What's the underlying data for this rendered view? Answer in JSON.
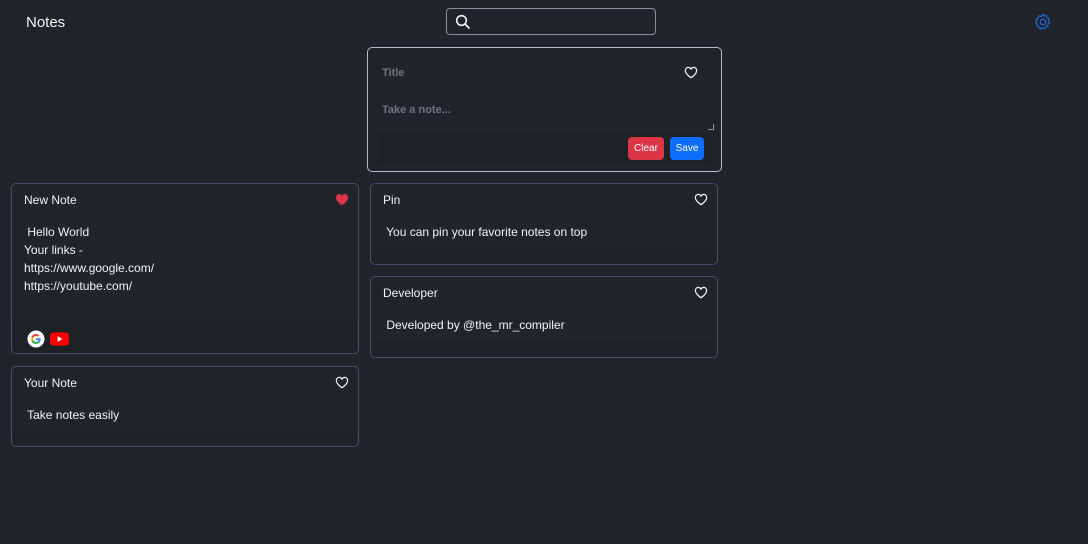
{
  "header": {
    "app_title": "Notes",
    "search": {
      "value": "",
      "placeholder": "",
      "icon": "search-icon"
    },
    "settings_icon": "gear-icon",
    "settings_color": "#1f64d6"
  },
  "composer": {
    "title_placeholder": "Title",
    "title_value": "",
    "note_placeholder": "Take a note...",
    "note_value": "",
    "favorite_icon": "heart-outline-icon",
    "clear_label": "Clear",
    "save_label": "Save",
    "clear_color": "#dc3545",
    "save_color": "#0d6efd"
  },
  "notes": [
    {
      "title": "New Note",
      "body": " Hello World\nYour links -\nhttps://www.google.com/\nhttps://youtube.com/",
      "favorite": true,
      "links": [
        {
          "name": "Google",
          "icon": "google-icon"
        },
        {
          "name": "YouTube",
          "icon": "youtube-icon"
        }
      ]
    },
    {
      "title": "Your Note",
      "body": " Take notes easily",
      "favorite": false
    },
    {
      "title": "Pin",
      "body": " You can pin your favorite notes on top",
      "favorite": false
    },
    {
      "title": "Developer",
      "body": " Developed by @the_mr_compiler",
      "favorite": false
    }
  ],
  "colors": {
    "background": "#212529",
    "card_border": "#51476a",
    "favorite_heart": "#dc3545"
  }
}
